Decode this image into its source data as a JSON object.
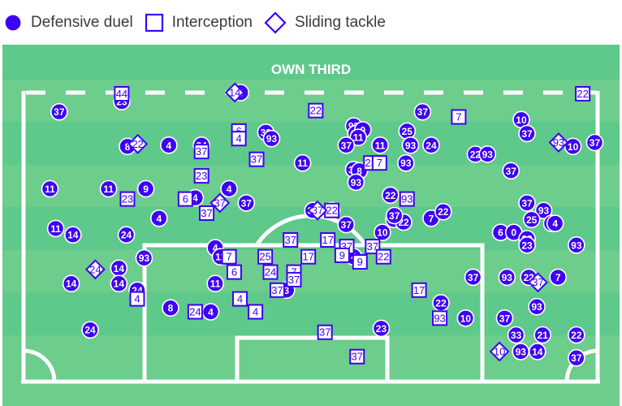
{
  "legend": {
    "items": [
      {
        "label": "Defensive duel",
        "icon": "filled-circle"
      },
      {
        "label": "Interception",
        "icon": "hollow-square"
      },
      {
        "label": "Sliding tackle",
        "icon": "hollow-diamond"
      }
    ]
  },
  "colors": {
    "marker": "#3d00f5",
    "pitch_light": "#6dcd8c",
    "pitch_dark": "#5ec98a",
    "lines": "#ffffff"
  },
  "chart_data": {
    "type": "scatter",
    "title": "OWN THIRD",
    "xlabel": "",
    "ylabel": "",
    "x_range": [
      0,
      100
    ],
    "y_range": [
      0,
      100
    ],
    "axes": "pitch coordinates: x = width of pitch (left to right, %), y = depth from own third line (0 = top dashed line) to own goal line (100)",
    "legend_placement": "top-left",
    "series": [
      {
        "name": "Defensive duel",
        "marker": "circle",
        "points": [
          {
            "x": 6.2,
            "y": 7.9,
            "label": "37"
          },
          {
            "x": 17.1,
            "y": 3.7,
            "label": "23"
          },
          {
            "x": 37.8,
            "y": 0,
            "label": "4"
          },
          {
            "x": 18.1,
            "y": 22.1,
            "label": "8"
          },
          {
            "x": 25.3,
            "y": 21.6,
            "label": "4"
          },
          {
            "x": 31.0,
            "y": 21.6,
            "label": "24"
          },
          {
            "x": 42.2,
            "y": 16.3,
            "label": "33"
          },
          {
            "x": 43.2,
            "y": 18.9,
            "label": "93"
          },
          {
            "x": 48.6,
            "y": 28.9,
            "label": "11"
          },
          {
            "x": 57.5,
            "y": 13.7,
            "label": "93"
          },
          {
            "x": 57.9,
            "y": 16.8,
            "label": "21"
          },
          {
            "x": 59.1,
            "y": 15.3,
            "label": "0"
          },
          {
            "x": 58.3,
            "y": 18.4,
            "label": "11"
          },
          {
            "x": 56.2,
            "y": 21.6,
            "label": "37"
          },
          {
            "x": 62.1,
            "y": 21.6,
            "label": "11"
          },
          {
            "x": 66.8,
            "y": 15.8,
            "label": "25"
          },
          {
            "x": 69.5,
            "y": 7.9,
            "label": "37"
          },
          {
            "x": 67.4,
            "y": 21.6,
            "label": "93"
          },
          {
            "x": 71.0,
            "y": 21.6,
            "label": "24"
          },
          {
            "x": 66.6,
            "y": 28.9,
            "label": "93"
          },
          {
            "x": 86.7,
            "y": 11.1,
            "label": "10"
          },
          {
            "x": 87.7,
            "y": 16.8,
            "label": "37"
          },
          {
            "x": 95.7,
            "y": 22.1,
            "label": "10"
          },
          {
            "x": 99.5,
            "y": 20.5,
            "label": "37"
          },
          {
            "x": 78.7,
            "y": 25.3,
            "label": "22"
          },
          {
            "x": 80.8,
            "y": 25.3,
            "label": "93"
          },
          {
            "x": 84.9,
            "y": 32.1,
            "label": "37"
          },
          {
            "x": 4.6,
            "y": 39.5,
            "label": "11"
          },
          {
            "x": 14.8,
            "y": 39.5,
            "label": "11"
          },
          {
            "x": 21.3,
            "y": 39.5,
            "label": "9"
          },
          {
            "x": 29.9,
            "y": 43.2,
            "label": "4"
          },
          {
            "x": 35.8,
            "y": 39.5,
            "label": "4"
          },
          {
            "x": 38.8,
            "y": 45.3,
            "label": "37"
          },
          {
            "x": 23.6,
            "y": 51.6,
            "label": "4"
          },
          {
            "x": 5.6,
            "y": 55.8,
            "label": "11"
          },
          {
            "x": 8.6,
            "y": 58.4,
            "label": "14"
          },
          {
            "x": 17.9,
            "y": 58.4,
            "label": "24"
          },
          {
            "x": 21.0,
            "y": 67.9,
            "label": "93"
          },
          {
            "x": 16.6,
            "y": 72.1,
            "label": "14"
          },
          {
            "x": 16.6,
            "y": 78.4,
            "label": "14"
          },
          {
            "x": 8.3,
            "y": 78.4,
            "label": "14"
          },
          {
            "x": 19.8,
            "y": 81.1,
            "label": "24"
          },
          {
            "x": 11.6,
            "y": 97.4,
            "label": "24"
          },
          {
            "x": 25.6,
            "y": 88.4,
            "label": "8"
          },
          {
            "x": 32.6,
            "y": 90.0,
            "label": "4"
          },
          {
            "x": 33.4,
            "y": 63.7,
            "label": "4"
          },
          {
            "x": 34.3,
            "y": 67.4,
            "label": "11"
          },
          {
            "x": 33.4,
            "y": 78.4,
            "label": "11"
          },
          {
            "x": 45.8,
            "y": 81.1,
            "label": "3"
          },
          {
            "x": 50.4,
            "y": 48.4,
            "label": "37"
          },
          {
            "x": 53.7,
            "y": 48.4,
            "label": "37"
          },
          {
            "x": 56.2,
            "y": 54.2,
            "label": "37"
          },
          {
            "x": 57.5,
            "y": 31.6,
            "label": "37"
          },
          {
            "x": 58.5,
            "y": 32.1,
            "label": "8"
          },
          {
            "x": 57.9,
            "y": 36.8,
            "label": "93"
          },
          {
            "x": 63.9,
            "y": 42.1,
            "label": "22"
          },
          {
            "x": 64.5,
            "y": 52.1,
            "label": "23"
          },
          {
            "x": 66.2,
            "y": 53.2,
            "label": "22"
          },
          {
            "x": 64.6,
            "y": 50.5,
            "label": "37"
          },
          {
            "x": 62.5,
            "y": 57.4,
            "label": "10"
          },
          {
            "x": 57.5,
            "y": 67.4,
            "label": "4"
          },
          {
            "x": 71.0,
            "y": 51.6,
            "label": "7"
          },
          {
            "x": 73.1,
            "y": 48.9,
            "label": "22"
          },
          {
            "x": 87.7,
            "y": 45.3,
            "label": "37"
          },
          {
            "x": 90.6,
            "y": 48.4,
            "label": "93"
          },
          {
            "x": 88.5,
            "y": 52.1,
            "label": "25"
          },
          {
            "x": 92.0,
            "y": 53.7,
            "label": "93"
          },
          {
            "x": 92.6,
            "y": 53.7,
            "label": "4"
          },
          {
            "x": 83.1,
            "y": 57.4,
            "label": "6"
          },
          {
            "x": 85.4,
            "y": 57.4,
            "label": "0"
          },
          {
            "x": 87.7,
            "y": 60.0,
            "label": "23"
          },
          {
            "x": 87.7,
            "y": 62.6,
            "label": "23"
          },
          {
            "x": 96.3,
            "y": 62.6,
            "label": "93"
          },
          {
            "x": 78.3,
            "y": 75.8,
            "label": "37"
          },
          {
            "x": 84.2,
            "y": 75.8,
            "label": "93"
          },
          {
            "x": 88.0,
            "y": 75.8,
            "label": "22"
          },
          {
            "x": 93.1,
            "y": 75.8,
            "label": "7"
          },
          {
            "x": 72.7,
            "y": 86.3,
            "label": "22"
          },
          {
            "x": 77.0,
            "y": 92.6,
            "label": "10"
          },
          {
            "x": 89.4,
            "y": 87.9,
            "label": "93"
          },
          {
            "x": 83.8,
            "y": 92.6,
            "label": "37"
          },
          {
            "x": 85.8,
            "y": 99.5,
            "label": "33"
          },
          {
            "x": 90.4,
            "y": 99.5,
            "label": "21"
          },
          {
            "x": 96.3,
            "y": 99.5,
            "label": "22"
          },
          {
            "x": 86.6,
            "y": 106.3,
            "label": "93"
          },
          {
            "x": 89.5,
            "y": 106.3,
            "label": "14"
          },
          {
            "x": 96.3,
            "y": 108.9,
            "label": "37"
          },
          {
            "x": 62.3,
            "y": 96.8,
            "label": "23"
          }
        ]
      },
      {
        "name": "Interception",
        "marker": "square",
        "points": [
          {
            "x": 17.1,
            "y": 0.5,
            "label": "44"
          },
          {
            "x": 50.9,
            "y": 7.4,
            "label": "22"
          },
          {
            "x": 75.8,
            "y": 10.0,
            "label": "7"
          },
          {
            "x": 97.4,
            "y": 0.5,
            "label": "22"
          },
          {
            "x": 37.5,
            "y": 15.8,
            "label": "6"
          },
          {
            "x": 37.5,
            "y": 18.9,
            "label": "4"
          },
          {
            "x": 31.0,
            "y": 24.2,
            "label": "37"
          },
          {
            "x": 40.6,
            "y": 27.4,
            "label": "37"
          },
          {
            "x": 60.5,
            "y": 28.9,
            "label": "23"
          },
          {
            "x": 62.0,
            "y": 28.9,
            "label": "7"
          },
          {
            "x": 31.0,
            "y": 34.2,
            "label": "23"
          },
          {
            "x": 18.1,
            "y": 43.7,
            "label": "23"
          },
          {
            "x": 28.2,
            "y": 43.7,
            "label": "6"
          },
          {
            "x": 31.9,
            "y": 49.5,
            "label": "37"
          },
          {
            "x": 66.8,
            "y": 43.7,
            "label": "93"
          },
          {
            "x": 53.7,
            "y": 48.4,
            "label": "22"
          },
          {
            "x": 46.5,
            "y": 60.5,
            "label": "37"
          },
          {
            "x": 53.0,
            "y": 60.5,
            "label": "17"
          },
          {
            "x": 56.3,
            "y": 63.2,
            "label": "37"
          },
          {
            "x": 60.8,
            "y": 63.2,
            "label": "37"
          },
          {
            "x": 55.5,
            "y": 66.8,
            "label": "9"
          },
          {
            "x": 58.6,
            "y": 69.5,
            "label": "9"
          },
          {
            "x": 62.7,
            "y": 67.4,
            "label": "22"
          },
          {
            "x": 49.6,
            "y": 67.4,
            "label": "17"
          },
          {
            "x": 35.8,
            "y": 67.4,
            "label": "7"
          },
          {
            "x": 42.1,
            "y": 67.4,
            "label": "25"
          },
          {
            "x": 36.7,
            "y": 73.7,
            "label": "6"
          },
          {
            "x": 43.0,
            "y": 73.7,
            "label": "24"
          },
          {
            "x": 47.1,
            "y": 73.7,
            "label": "7"
          },
          {
            "x": 47.1,
            "y": 76.8,
            "label": "37"
          },
          {
            "x": 44.2,
            "y": 81.1,
            "label": "37"
          },
          {
            "x": 37.7,
            "y": 84.7,
            "label": "4"
          },
          {
            "x": 40.4,
            "y": 90.0,
            "label": "4"
          },
          {
            "x": 29.9,
            "y": 90.0,
            "label": "24"
          },
          {
            "x": 19.8,
            "y": 84.7,
            "label": "4"
          },
          {
            "x": 52.5,
            "y": 98.4,
            "label": "37"
          },
          {
            "x": 58.1,
            "y": 108.4,
            "label": "37"
          },
          {
            "x": 68.9,
            "y": 81.1,
            "label": "17"
          },
          {
            "x": 72.5,
            "y": 92.6,
            "label": "93"
          }
        ]
      },
      {
        "name": "Sliding tackle",
        "marker": "diamond",
        "points": [
          {
            "x": 36.8,
            "y": 0,
            "label": "14"
          },
          {
            "x": 19.9,
            "y": 21.1,
            "label": "22"
          },
          {
            "x": 34.2,
            "y": 45.3,
            "label": "37"
          },
          {
            "x": 51.2,
            "y": 48.4,
            "label": "37"
          },
          {
            "x": 12.5,
            "y": 72.6,
            "label": "24"
          },
          {
            "x": 89.6,
            "y": 77.9,
            "label": "37"
          },
          {
            "x": 93.2,
            "y": 20.5,
            "label": "93"
          },
          {
            "x": 82.9,
            "y": 106.3,
            "label": "10"
          }
        ]
      }
    ]
  }
}
